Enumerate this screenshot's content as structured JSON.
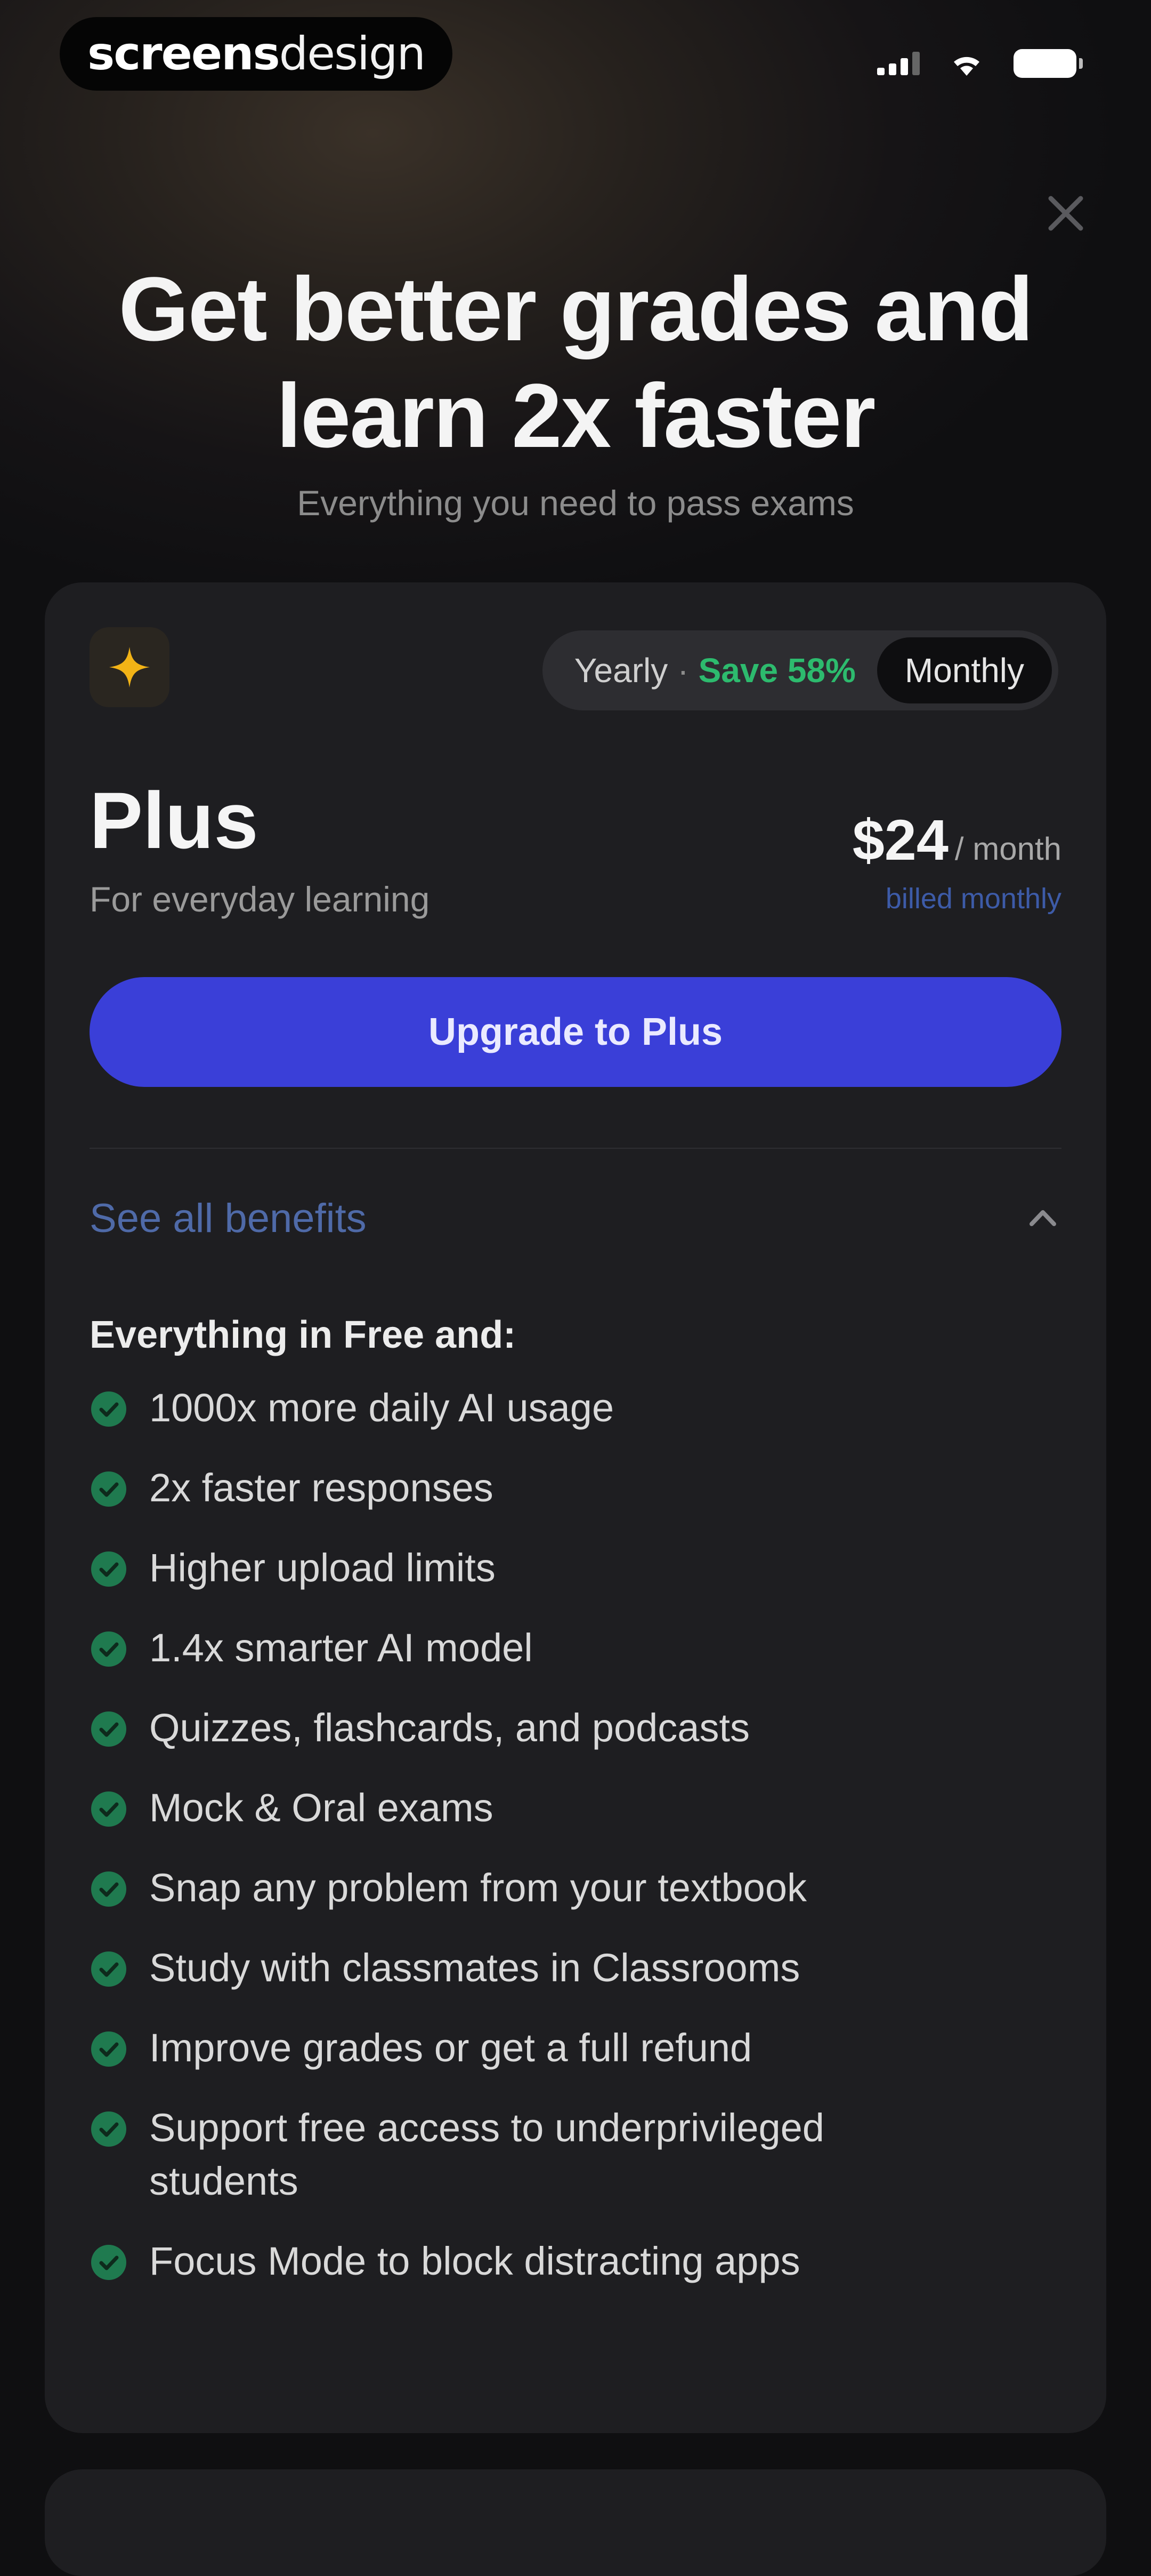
{
  "brand": {
    "part1": "screens",
    "part2": "design"
  },
  "hero": {
    "title_line1": "Get better grades and",
    "title_line2": "learn 2x faster",
    "subtitle": "Everything you need to pass exams"
  },
  "toggle": {
    "yearly": "Yearly",
    "separator": "·",
    "save": "Save 58%",
    "monthly": "Monthly"
  },
  "plan": {
    "name": "Plus",
    "description": "For everyday learning",
    "price": "$24",
    "price_unit": "/ month",
    "billed": "billed monthly",
    "cta": "Upgrade to Plus"
  },
  "benefits": {
    "toggle_label": "See all benefits",
    "heading": "Everything in Free and:",
    "items": [
      "1000x more daily AI usage",
      "2x faster responses",
      "Higher upload limits",
      "1.4x smarter AI model",
      "Quizzes, flashcards, and podcasts",
      "Mock & Oral exams",
      "Snap any problem from your textbook",
      "Study with classmates in Classrooms",
      "Improve grades or get a full refund",
      "Support free access to underprivileged students",
      "Focus Mode to block distracting apps"
    ]
  },
  "colors": {
    "accent_blue": "#3a3fd8",
    "save_green": "#2dbb6e",
    "check_green": "#1f7a4f",
    "plan_icon": "#f2b316"
  },
  "icons": {
    "close": "close-icon",
    "plan": "sparkle-icon",
    "chevron": "chevron-up-icon",
    "check": "check-circle-icon"
  }
}
